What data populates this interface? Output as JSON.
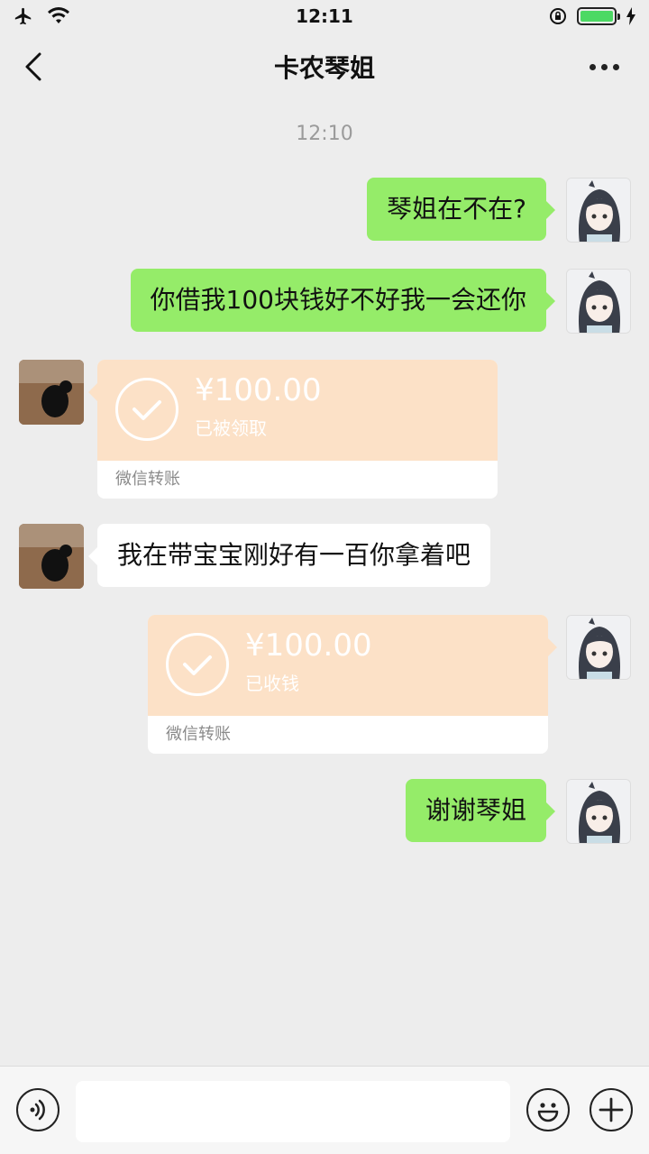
{
  "status_bar": {
    "time": "12:11",
    "left_icons": [
      "airplane-icon",
      "wifi-icon"
    ],
    "right_icons": [
      "rotation-lock-icon",
      "battery-icon",
      "charging-icon"
    ],
    "battery_level": 1.0,
    "battery_color": "#4cd964"
  },
  "header": {
    "title": "卡农琴姐",
    "back_icon": "chevron-left-icon",
    "more_icon": "more-dots-icon"
  },
  "chat": {
    "timestamp": "12:10",
    "messages": [
      {
        "from": "me",
        "type": "text",
        "text": "琴姐在不在?"
      },
      {
        "from": "me",
        "type": "text",
        "text": "你借我100块钱好不好我一会还你"
      },
      {
        "from": "other",
        "type": "transfer",
        "amount": "¥100.00",
        "status": "已被领取",
        "footer": "微信转账"
      },
      {
        "from": "other",
        "type": "text",
        "text": "我在带宝宝刚好有一百你拿着吧"
      },
      {
        "from": "me",
        "type": "transfer",
        "amount": "¥100.00",
        "status": "已收钱",
        "footer": "微信转账"
      },
      {
        "from": "me",
        "type": "text",
        "text": "谢谢琴姐"
      }
    ]
  },
  "input_bar": {
    "voice_icon": "voice-icon",
    "text_value": "",
    "emoji_icon": "emoji-icon",
    "plus_icon": "plus-circle-icon"
  },
  "colors": {
    "background": "#ededed",
    "my_bubble": "#95ec69",
    "other_bubble": "#ffffff",
    "transfer": "#fce1c7"
  }
}
